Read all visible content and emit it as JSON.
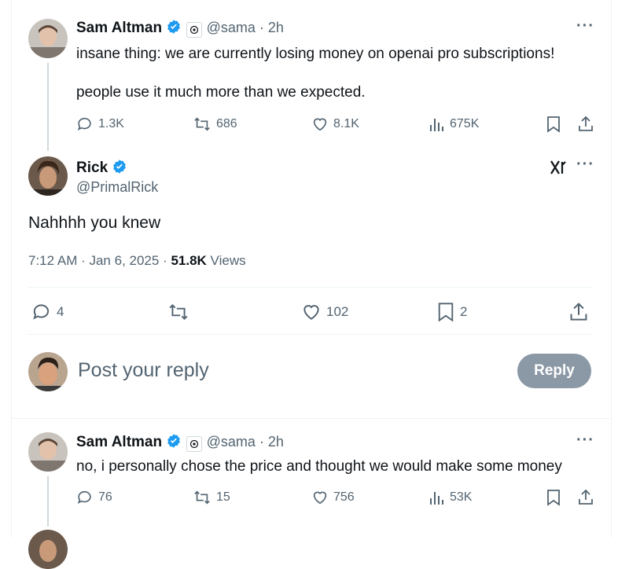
{
  "tweet1": {
    "name": "Sam Altman",
    "handle_time": "@sama · 2h",
    "line1": "insane thing: we are currently losing money on openai pro subscriptions!",
    "line2": "people use it much more than we expected.",
    "replies": "1.3K",
    "reposts": "686",
    "likes": "8.1K",
    "views": "675K"
  },
  "main_tweet": {
    "name": "Rick",
    "handle": "@PrimalRick",
    "text": "Nahhhh you knew",
    "timestamp": "7:12 AM · Jan 6, 2025 · ",
    "views_count": "51.8K",
    "views_label": " Views",
    "replies": "4",
    "likes": "102",
    "bookmarks": "2"
  },
  "composer": {
    "placeholder": "Post your reply",
    "reply_label": "Reply"
  },
  "tweet2": {
    "name": "Sam Altman",
    "handle_time": "@sama · 2h",
    "text": "no, i personally chose the price and thought we would make some money",
    "replies": "76",
    "reposts": "15",
    "likes": "756",
    "views": "53K"
  },
  "icons": {
    "verified": "verified-badge-icon",
    "reply": "reply-icon",
    "repost": "repost-icon",
    "like": "heart-icon",
    "views": "views-icon",
    "bookmark": "bookmark-icon",
    "share": "share-icon",
    "more": "more-icon",
    "grok": "grok-icon"
  },
  "colors": {
    "verified_blue": "#1d9bf0",
    "muted_text": "#536471",
    "reply_button_bg": "#8b98a5"
  }
}
